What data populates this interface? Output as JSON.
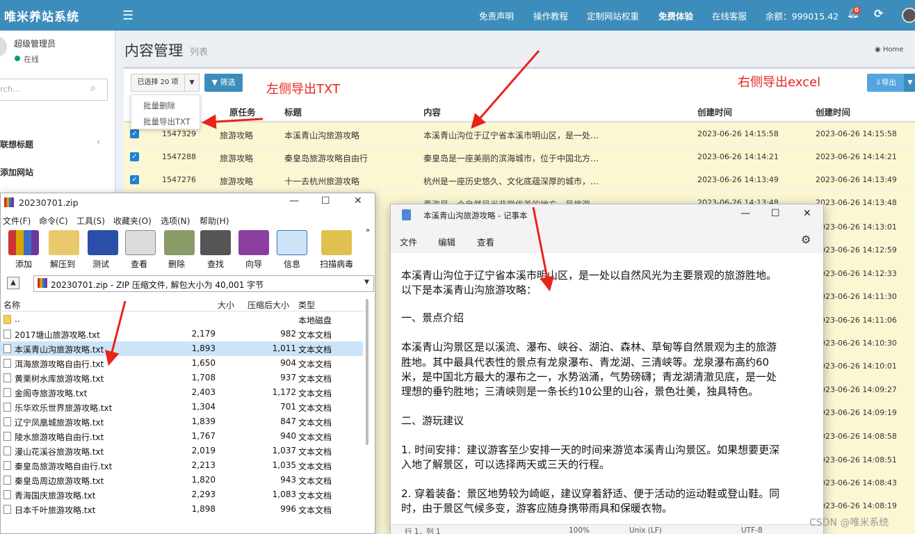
{
  "topbar": {
    "brand": "唯米养站系统",
    "nav": [
      "免责声明",
      "操作教程",
      "定制网站权重",
      "免费体验",
      "在线客服"
    ],
    "balance": "余额：999015.42",
    "notif_count": "0"
  },
  "sidebar": {
    "username": "超级管理员",
    "status": "在线",
    "search_placeholder": "rch...",
    "items": [
      "联想标题",
      "添加网站"
    ]
  },
  "page": {
    "title": "内容管理",
    "subtitle": "列表",
    "breadcrumb": "Home"
  },
  "toolbar": {
    "selected": "已选择 20 项",
    "filter": "筛选",
    "dropdown": [
      "批量删除",
      "批量导出TXT"
    ],
    "export": "导出"
  },
  "annotations": {
    "left": "左侧导出TXT",
    "right": "右侧导出excel"
  },
  "table": {
    "headers": [
      "原任务",
      "标题",
      "内容",
      "创建时间",
      "创建时间"
    ],
    "rows": [
      {
        "id": "1547329",
        "task": "旅游攻略",
        "title": "本溪青山沟旅游攻略",
        "content": "本溪青山沟位于辽宁省本溪市明山区，是一处…",
        "t1": "2023-06-26 14:15:58",
        "t2": "2023-06-26 14:15:58"
      },
      {
        "id": "1547288",
        "task": "旅游攻略",
        "title": "秦皇岛旅游攻略自由行",
        "content": "秦皇岛是一座美丽的滨海城市，位于中国北方…",
        "t1": "2023-06-26 14:14:21",
        "t2": "2023-06-26 14:14:21"
      },
      {
        "id": "1547276",
        "task": "旅游攻略",
        "title": "十一去杭州旅游攻略",
        "content": "杭州是一座历史悠久、文化底蕴深厚的城市，…",
        "t1": "2023-06-26 14:13:49",
        "t2": "2023-06-26 14:13:49"
      },
      {
        "id": "",
        "task": "",
        "title": "",
        "content": "青海是一个自然风光非常优美的地方，是旅游",
        "t1": "2023-06-26 14:13:48",
        "t2": "2023-06-26 14:13:48"
      }
    ],
    "more_times": [
      "2023-06-26 14:13:01",
      "2023-06-26 14:12:59",
      "2023-06-26 14:12:33",
      "2023-06-26 14:11:30",
      "2023-06-26 14:11:06",
      "2023-06-26 14:10:30",
      "2023-06-26 14:10:01",
      "2023-06-26 14:09:27",
      "2023-06-26 14:09:19",
      "2023-06-26 14:08:58",
      "2023-06-26 14:08:51",
      "2023-06-26 14:08:43",
      "2023-06-26 14:08:19"
    ]
  },
  "zip": {
    "title": "20230701.zip",
    "menu": [
      "文件(F)",
      "命令(C)",
      "工具(S)",
      "收藏夹(O)",
      "选项(N)",
      "帮助(H)"
    ],
    "tools": [
      "添加",
      "解压到",
      "测试",
      "查看",
      "删除",
      "查找",
      "向导",
      "信息",
      "扫描病毒"
    ],
    "path": "20230701.zip - ZIP 压缩文件, 解包大小为 40,001 字节",
    "headers": [
      "名称",
      "大小",
      "压缩后大小",
      "类型"
    ],
    "files": [
      {
        "name": "..",
        "size": "",
        "packed": "",
        "type": "本地磁盘"
      },
      {
        "name": "2017塘山旅游攻略.txt",
        "size": "2,179",
        "packed": "982",
        "type": "文本文档"
      },
      {
        "name": "本溪青山沟旅游攻略.txt",
        "size": "1,893",
        "packed": "1,011",
        "type": "文本文档"
      },
      {
        "name": "洱海旅游攻略自由行.txt",
        "size": "1,650",
        "packed": "904",
        "type": "文本文档"
      },
      {
        "name": "黄栗树水库旅游攻略.txt",
        "size": "1,708",
        "packed": "937",
        "type": "文本文档"
      },
      {
        "name": "金阁寺旅游攻略.txt",
        "size": "2,403",
        "packed": "1,172",
        "type": "文本文档"
      },
      {
        "name": "乐华欢乐世界旅游攻略.txt",
        "size": "1,304",
        "packed": "701",
        "type": "文本文档"
      },
      {
        "name": "辽宁凤凰城旅游攻略.txt",
        "size": "1,839",
        "packed": "847",
        "type": "文本文档"
      },
      {
        "name": "陵水旅游攻略自由行.txt",
        "size": "1,767",
        "packed": "940",
        "type": "文本文档"
      },
      {
        "name": "漫山花溪谷旅游攻略.txt",
        "size": "2,019",
        "packed": "1,037",
        "type": "文本文档"
      },
      {
        "name": "秦皇岛旅游攻略自由行.txt",
        "size": "2,213",
        "packed": "1,035",
        "type": "文本文档"
      },
      {
        "name": "秦皇岛周边旅游攻略.txt",
        "size": "1,820",
        "packed": "943",
        "type": "文本文档"
      },
      {
        "name": "青海国庆旅游攻略.txt",
        "size": "2,293",
        "packed": "1,083",
        "type": "文本文档"
      },
      {
        "name": "日本千叶旅游攻略.txt",
        "size": "1,898",
        "packed": "996",
        "type": "文本文档"
      }
    ]
  },
  "notepad": {
    "title": "本溪青山沟旅游攻略 - 记事本",
    "menu": [
      "文件",
      "编辑",
      "查看"
    ],
    "lines": [
      "本溪青山沟位于辽宁省本溪市明山区，是一处以自然风光为主要景观的旅游胜地。",
      "以下是本溪青山沟旅游攻略：",
      "一、景点介绍",
      "本溪青山沟景区是以溪流、瀑布、峡谷、湖泊、森林、草甸等自然景观为主的旅游",
      "胜地。其中最具代表性的景点有龙泉瀑布、青龙湖、三清峡等。龙泉瀑布高约60",
      "米，是中国北方最大的瀑布之一，水势汹涌，气势磅礴；青龙湖清澈见底，是一处",
      "理想的垂钓胜地；三清峡则是一条长约10公里的山谷，景色壮美，独具特色。",
      "二、游玩建议",
      "1. 时间安排：建议游客至少安排一天的时间来游览本溪青山沟景区。如果想要更深",
      "入地了解景区，可以选择两天或三天的行程。",
      "2. 穿着装备：景区地势较为崎岖，建议穿着舒适、便于活动的运动鞋或登山鞋。同",
      "时，由于景区气候多变，游客应随身携带雨具和保暖衣物。"
    ],
    "status": [
      "行 1，列 1",
      "100%",
      "Unix (LF)",
      "UTF-8"
    ]
  },
  "watermark": "CSDN @唯米系统"
}
